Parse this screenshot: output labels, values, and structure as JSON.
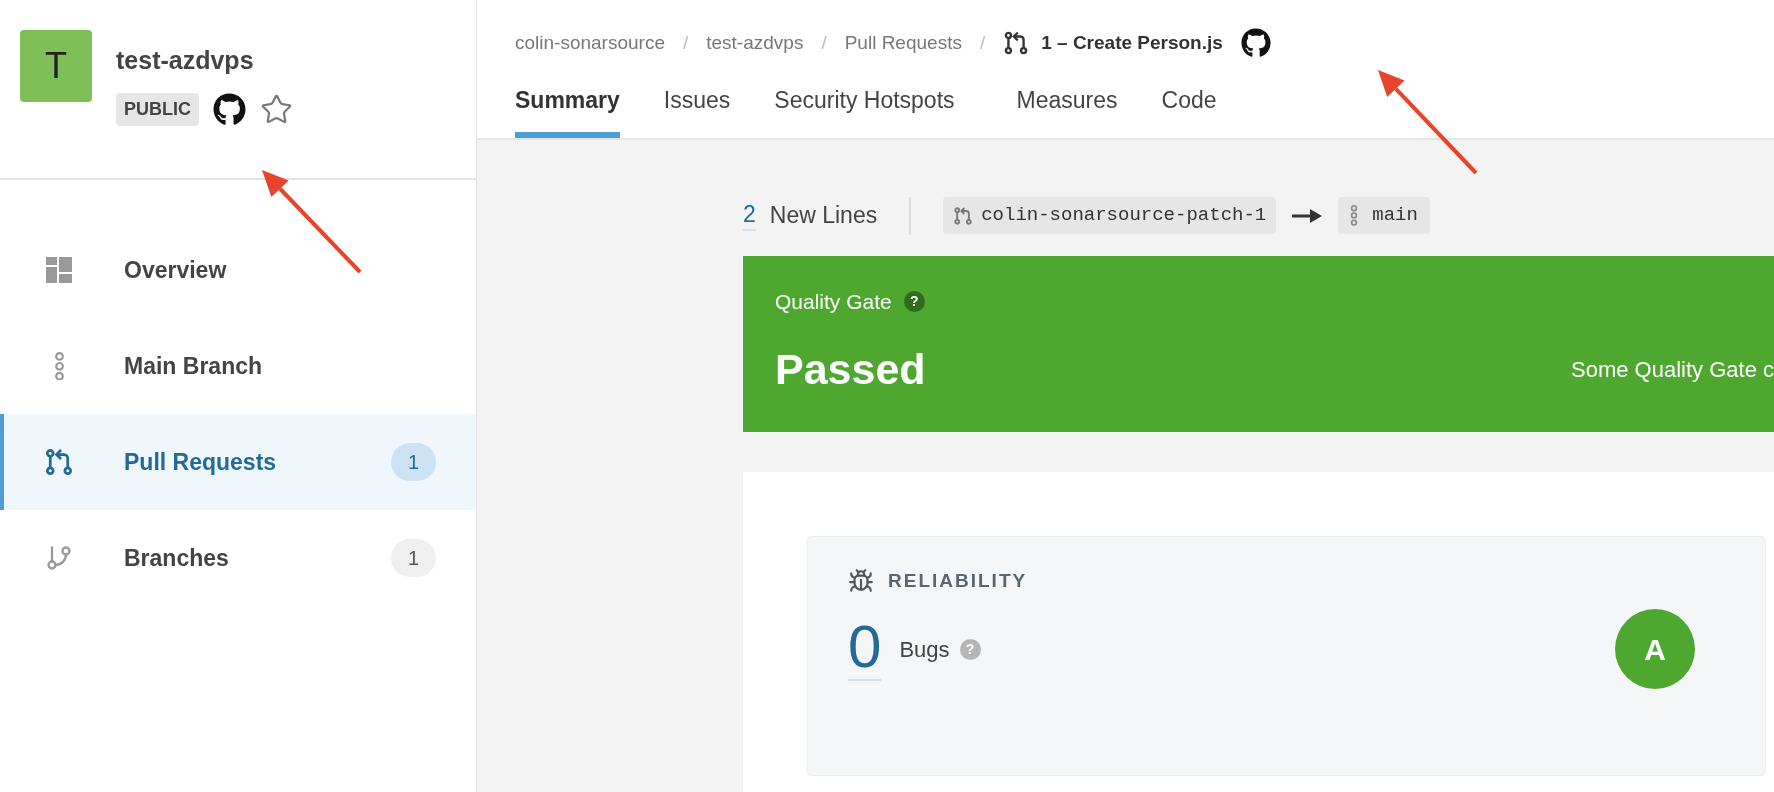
{
  "project": {
    "avatar_letter": "T",
    "name": "test-azdvps",
    "visibility": "PUBLIC"
  },
  "nav": [
    {
      "label": "Overview",
      "selected": false
    },
    {
      "label": "Main Branch",
      "selected": false
    },
    {
      "label": "Pull Requests",
      "count": "1",
      "selected": true
    },
    {
      "label": "Branches",
      "count": "1",
      "selected": false
    }
  ],
  "breadcrumb": [
    {
      "label": "colin-sonarsource",
      "separator": "/"
    },
    {
      "label": "test-azdvps",
      "separator": "/"
    },
    {
      "label": "Pull Requests",
      "separator": "/"
    }
  ],
  "breadcrumb_current": "1 – Create Person.js",
  "tabs": [
    {
      "label": "Summary",
      "selected": true
    },
    {
      "label": "Issues",
      "selected": false
    },
    {
      "label": "Security Hotspots",
      "selected": false
    },
    {
      "label": "Measures",
      "selected": false
    },
    {
      "label": "Code",
      "selected": false
    }
  ],
  "new_lines": {
    "count": "2",
    "label": "New Lines"
  },
  "source_branch": "colin-sonarsource-patch-1",
  "target_branch": "main",
  "quality_gate": {
    "title": "Quality Gate",
    "help": "?",
    "status": "Passed",
    "message": "Some Quality Gate c"
  },
  "reliability": {
    "title": "RELIABILITY",
    "value": "0",
    "label": "Bugs",
    "help": "?",
    "rating": "A"
  }
}
